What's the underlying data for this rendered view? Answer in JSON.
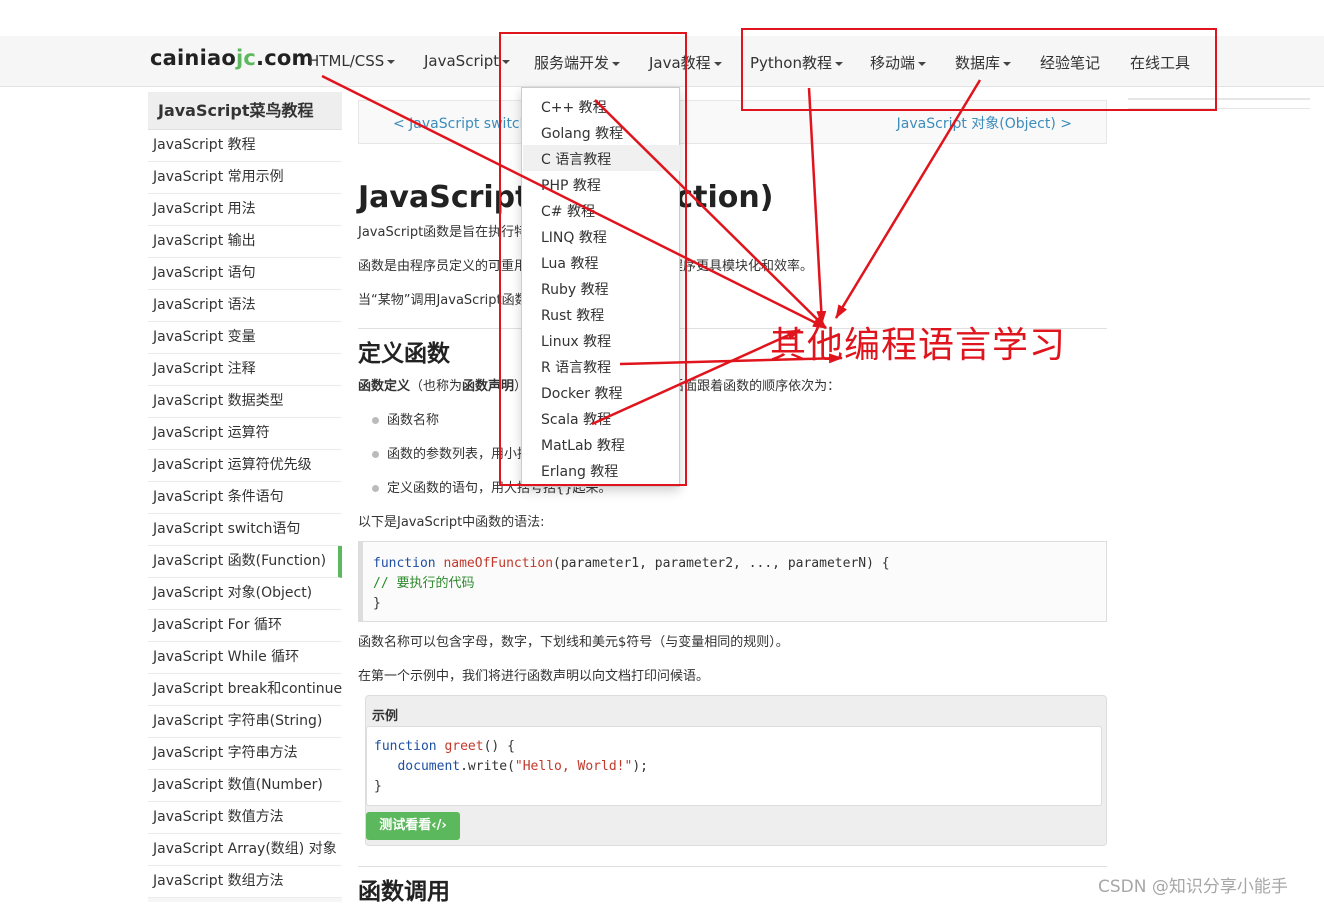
{
  "header": {
    "logo_main": "cainiao",
    "logo_accent": "jc",
    "logo_tail": ".com",
    "nav": [
      {
        "label": "HTML/CSS",
        "dropdown": true
      },
      {
        "label": "JavaScript",
        "dropdown": true
      },
      {
        "label": "服务端开发",
        "dropdown": true
      },
      {
        "label": "Java教程",
        "dropdown": true
      },
      {
        "label": "Python教程",
        "dropdown": true
      },
      {
        "label": "移动端",
        "dropdown": true
      },
      {
        "label": "数据库",
        "dropdown": true
      },
      {
        "label": "经验笔记",
        "dropdown": false
      },
      {
        "label": "在线工具",
        "dropdown": false
      }
    ]
  },
  "dropdown": {
    "items": [
      "C++ 教程",
      "Golang 教程",
      "C 语言教程",
      "PHP 教程",
      "C# 教程",
      "LINQ 教程",
      "Lua 教程",
      "Ruby 教程",
      "Rust 教程",
      "Linux 教程",
      "R 语言教程",
      "Docker 教程",
      "Scala 教程",
      "MatLab 教程",
      "Erlang 教程"
    ]
  },
  "sidebar": {
    "title": "JavaScript菜鸟教程",
    "items": [
      "JavaScript 教程",
      "JavaScript 常用示例",
      "JavaScript 用法",
      "JavaScript 输出",
      "JavaScript 语句",
      "JavaScript 语法",
      "JavaScript 变量",
      "JavaScript 注释",
      "JavaScript 数据类型",
      "JavaScript 运算符",
      "JavaScript 运算符优先级",
      "JavaScript 条件语句",
      "JavaScript switch语句",
      "JavaScript 函数(Function)",
      "JavaScript 对象(Object)",
      "JavaScript For 循环",
      "JavaScript While 循环",
      "JavaScript break和continue",
      "JavaScript 字符串(String)",
      "JavaScript 字符串方法",
      "JavaScript 数值(Number)",
      "JavaScript 数值方法",
      "JavaScript Array(数组) 对象",
      "JavaScript 数组方法"
    ]
  },
  "pager": {
    "prev": "<  JavaScript switch语句",
    "next": "JavaScript 对象(Object)  >"
  },
  "content": {
    "title": "JavaScript 函数(Function)",
    "intro1": "JavaScript函数是旨在执行特定任务的代码块。",
    "intro2": "函数是由程序员定义的可重用代码块，函数可以让您的程序更具模块化和效率。",
    "intro3": "当“某物”调用JavaScript函数时，函数就会被执行。",
    "section1_title": "定义函数",
    "def_bold1": "函数定义",
    "def_mid": "（也称为",
    "def_bold2": "函数声明",
    "def_rest": "）由function关键字组成，后面跟着函数的顺序依次为：",
    "bullets": [
      "函数名称",
      "函数的参数列表，用小括号括起来并以逗号分隔",
      "定义函数的语句，用大括号括{}起来。"
    ],
    "syntax_intro": "以下是JavaScript中函数的语法:",
    "code_kw": "function",
    "code_fn": "nameOfFunction",
    "code_args": "(parameter1, parameter2, ..., parameterN) {",
    "code_comment": " // 要执行的代码",
    "code_close": " }",
    "naming_note": "函数名称可以包含字母，数字，下划线和美元$符号（与变量相同的规则）。",
    "example_intro": "在第一个示例中，我们将进行函数声明以向文档打印问候语。",
    "example_title": "示例",
    "ex_kw": "function",
    "ex_fn": "greet",
    "ex_open": "() {",
    "ex_obj": "document",
    "ex_method": ".write(",
    "ex_str": "\"Hello, World!\"",
    "ex_end": ");",
    "ex_close": "}",
    "try_button": "测试看看‹/›",
    "section2_title": "函数调用"
  },
  "annotation": {
    "label": "其他编程语言学习",
    "color": "#e0141c"
  },
  "watermark": "CSDN @知识分享小能手",
  "colors": {
    "accent_green": "#5cb85c",
    "link_blue": "#3c8dbc"
  }
}
